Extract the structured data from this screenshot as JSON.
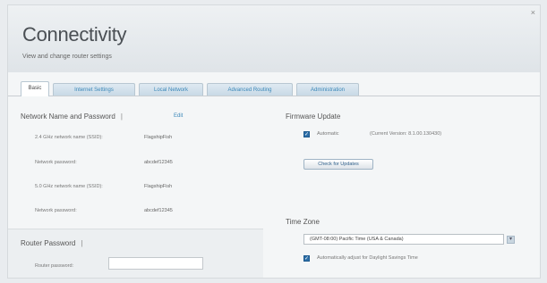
{
  "window": {
    "close_glyph": "×"
  },
  "header": {
    "title": "Connectivity",
    "subtitle": "View and change router settings"
  },
  "tabs": [
    {
      "label": "Basic",
      "active": true
    },
    {
      "label": "Internet Settings"
    },
    {
      "label": "Local Network"
    },
    {
      "label": "Advanced Routing"
    },
    {
      "label": "Administration"
    }
  ],
  "network": {
    "title": "Network Name and Password",
    "info": "|",
    "edit": "Edit",
    "rows": [
      {
        "label": "2.4 GHz network name (SSID):",
        "value": "FlagshipFish"
      },
      {
        "label": "Network password:",
        "value": "abcdef12345"
      },
      {
        "label": "5.0 GHz network name (SSID):",
        "value": "FlagshipFish"
      },
      {
        "label": "Network password:",
        "value": "abcdef12345"
      }
    ]
  },
  "router_password": {
    "title": "Router Password",
    "info": "|",
    "field_label": "Router password:",
    "field_value": ""
  },
  "firmware": {
    "title": "Firmware Update",
    "checkbox_checked": true,
    "automatic_label": "Automatic",
    "current_version": "(Current Version: 8.1.00.130430)",
    "check_button": "Check for Updates"
  },
  "timezone": {
    "title": "Time Zone",
    "selected": "(GMT-08:00) Pacific Time (USA & Canada)",
    "dst_checked": true,
    "dst_label": "Automatically adjust for Daylight Savings Time"
  },
  "colors": {
    "accent": "#3a87b8",
    "checkbox": "#2d6fa8"
  }
}
